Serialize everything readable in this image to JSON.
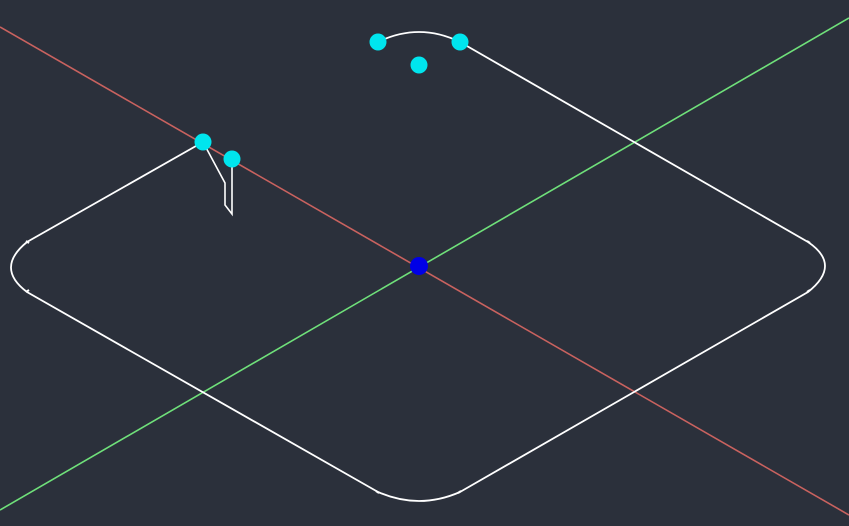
{
  "viewport": {
    "background": "#2b303b",
    "view_mode": "isometric"
  },
  "axes": {
    "x_axis_color": "#c9625f",
    "y_axis_color": "#6fe07a"
  },
  "geometry": {
    "outline_color": "#ffffff",
    "shape": "rounded-square-plate"
  },
  "grips": {
    "selected_color": "#00e5ee",
    "origin_color": "#0000e6"
  }
}
